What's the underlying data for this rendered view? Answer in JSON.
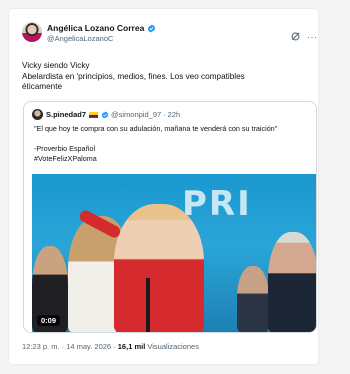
{
  "author": {
    "name": "Angélica Lozano Correa",
    "handle": "@AngelicaLozanoC"
  },
  "icons": {
    "verified": "verified-badge-icon",
    "grok": "grok-icon",
    "more": "more-options-icon",
    "flag": "colombia-flag-icon"
  },
  "colors": {
    "verified": "#1d9bf0",
    "link": "#1d9bf0",
    "secondary_text": "#536471"
  },
  "tweet": {
    "line1": "Vicky siendo Vicky",
    "line2": "Abelardista en 'principios, medios, fines. Los veo compatibles",
    "line3": "éticamente"
  },
  "quote": {
    "name": "S.pinedad7",
    "handle": "@simonpid_97",
    "separator": "·",
    "time": "22h",
    "body_line1": "\"El que hoy te compra con su adulación, mañana te venderá con su traición\"",
    "body_line2": "-Proverbio Español",
    "body_line3": "#VoteFelizXPaloma",
    "video_duration": "0:09",
    "video_banner_text": "PRI"
  },
  "footer": {
    "timestamp": "12:23 p. m. · 14 may. 2026 ·",
    "views_count": "16,1 mil",
    "views_label": "Visualizaciones"
  },
  "more_glyph": "···"
}
